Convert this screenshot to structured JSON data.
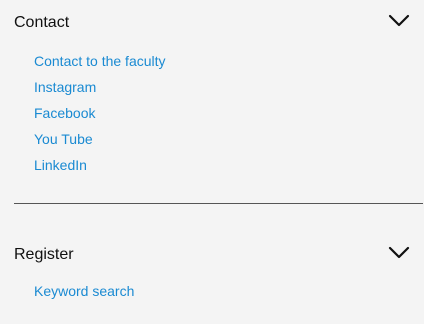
{
  "contact": {
    "title": "Contact",
    "toggle_icon": "chevron-down-icon",
    "links": [
      {
        "label": "Contact to the faculty"
      },
      {
        "label": "Instagram"
      },
      {
        "label": "Facebook"
      },
      {
        "label": "You Tube"
      },
      {
        "label": "LinkedIn"
      }
    ]
  },
  "register": {
    "title": "Register",
    "toggle_icon": "chevron-down-icon",
    "links": [
      {
        "label": "Keyword search"
      }
    ]
  },
  "colors": {
    "background": "#f4f4f4",
    "link": "#1a8ad2",
    "title": "#111111",
    "divider": "#555555"
  }
}
